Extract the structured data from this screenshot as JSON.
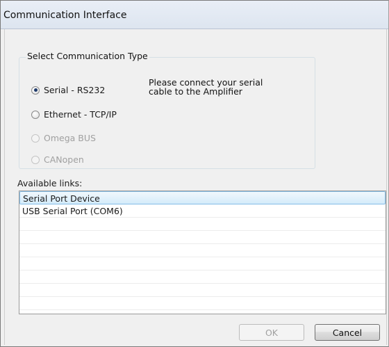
{
  "window": {
    "title": "Communication Interface"
  },
  "comm_type": {
    "legend": "Select Communication Type",
    "options": [
      {
        "label": "Serial - RS232",
        "checked": true,
        "enabled": true
      },
      {
        "label": "Ethernet - TCP/IP",
        "checked": false,
        "enabled": true
      },
      {
        "label": "Omega BUS",
        "checked": false,
        "enabled": false
      },
      {
        "label": "CANopen",
        "checked": false,
        "enabled": false
      }
    ],
    "hint": "Please connect your serial cable to the Amplifier"
  },
  "links": {
    "label": "Available links:",
    "items": [
      {
        "label": "Serial Port Device",
        "selected": true
      },
      {
        "label": "USB Serial Port (COM6)",
        "selected": false
      }
    ]
  },
  "buttons": {
    "ok_label": "OK",
    "ok_enabled": false,
    "cancel_label": "Cancel"
  },
  "colors": {
    "window_bg": "#f0f0f0",
    "selection_border": "#84bde7",
    "selection_fill": "#d4ebfa",
    "disabled_text": "#a0a0a0"
  }
}
